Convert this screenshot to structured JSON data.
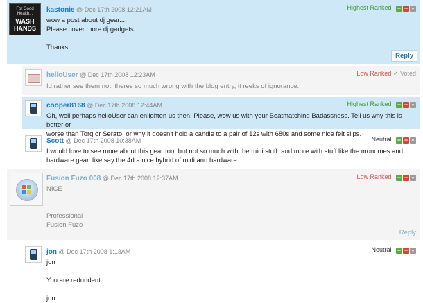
{
  "comments": [
    {
      "username": "kastonie",
      "date": "Dec 17th 2008 12:21AM",
      "rank": "Highest Ranked",
      "rank_color": "#3a9a3a",
      "lines": [
        "wow a post about dj gear....",
        "Please cover more dj gadgets",
        "",
        "Thanks!"
      ],
      "reply": "Reply",
      "avatar_text": [
        "For Good",
        "Health...",
        "WASH",
        "HANDS"
      ]
    },
    {
      "username": "helloUser",
      "date": "Dec 17th 2008 12:23AM",
      "rank": "Low Ranked",
      "rank_color": "#d9534f",
      "voted": "Voted",
      "lines": [
        "Id rather see them not, theres so much wrong with the blog entry, it reeks of ignorance."
      ]
    },
    {
      "username": "cooper8168",
      "date": "Dec 17th 2008 12:44AM",
      "rank": "Highest Ranked",
      "rank_color": "#3a9a3a",
      "lines": [
        "Oh, well perhaps helloUser can enlighten us then. Please, wow us with your Beatmatching Badassness. Tell us why this is better or",
        "worse than Torq or Serato, or why it doesn't hold a candle to a pair of 12s with 680s and some nice felt slips."
      ]
    },
    {
      "username": "Scott",
      "date": "Dec 17th 2008 10:38AM",
      "rank": "Neutral",
      "rank_color": "#333333",
      "lines": [
        "I would love to see more about this gear too, but not so much with the midi stuff. and more with stuff like the monomes and",
        "hardware gear. like say the 4d a nice hybrid of midi and hardware."
      ]
    },
    {
      "username": "Fusion Fuzo 008",
      "date": "Dec 17th 2008 12:37AM",
      "rank": "Low Ranked",
      "rank_color": "#d9534f",
      "lines": [
        "NICE",
        "",
        "",
        "",
        "Professional",
        "Fusion Fuzo"
      ],
      "reply": "Reply"
    },
    {
      "username": "jon",
      "date": "Dec 17th 2008 1:13AM",
      "rank": "Neutral",
      "rank_color": "#333333",
      "lines": [
        "jon",
        "",
        "You are redundent.",
        "",
        "jon"
      ]
    }
  ],
  "at_symbol": "@",
  "buttons": {
    "plus": "+",
    "minus": "−",
    "flag": "▪",
    "check": "✓"
  }
}
